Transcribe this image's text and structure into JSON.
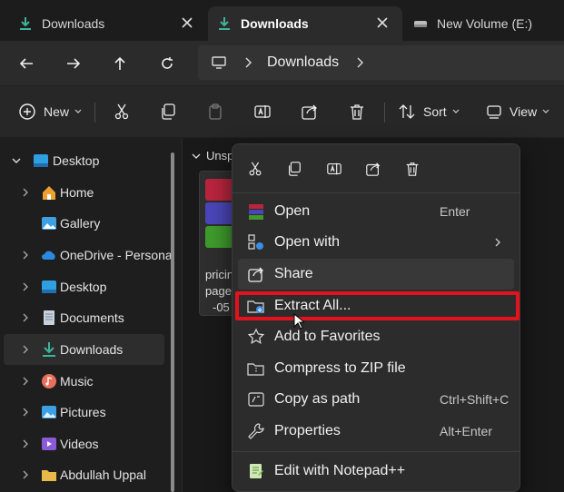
{
  "tabs": [
    {
      "label": "Downloads",
      "icon": "download-icon",
      "active": false
    },
    {
      "label": "Downloads",
      "icon": "download-icon",
      "active": true
    },
    {
      "label": "New Volume (E:)",
      "icon": "drive-icon",
      "active": false
    }
  ],
  "address": {
    "segments": [
      "Downloads"
    ],
    "root_icon": "monitor-icon"
  },
  "commandbar": {
    "new_label": "New",
    "sort_label": "Sort",
    "view_label": "View"
  },
  "sidebar": {
    "items": [
      {
        "label": "Desktop",
        "icon": "desktop-folder-icon",
        "expanded": true
      },
      {
        "label": "Home",
        "icon": "home-icon"
      },
      {
        "label": "Gallery",
        "icon": "gallery-icon"
      },
      {
        "label": "OneDrive - Personal",
        "icon": "onedrive-icon"
      },
      {
        "label": "Desktop",
        "icon": "desktop-folder-icon"
      },
      {
        "label": "Documents",
        "icon": "documents-icon"
      },
      {
        "label": "Downloads",
        "icon": "download-icon",
        "selected": true
      },
      {
        "label": "Music",
        "icon": "music-icon"
      },
      {
        "label": "Pictures",
        "icon": "pictures-icon"
      },
      {
        "label": "Videos",
        "icon": "videos-icon"
      },
      {
        "label": "Abdullah Uppal",
        "icon": "folder-icon"
      }
    ]
  },
  "content": {
    "group_header": "Unsp",
    "file_name_lines": [
      "pricin",
      "page",
      "-05"
    ]
  },
  "context_menu": {
    "quick_actions": [
      "cut-icon",
      "copy-icon",
      "rename-icon",
      "share-icon",
      "delete-icon"
    ],
    "items": [
      {
        "label": "Open",
        "shortcut": "Enter",
        "icon": "winrar-icon"
      },
      {
        "label": "Open with",
        "shortcut": "",
        "icon": "open-with-icon",
        "submenu": true
      },
      {
        "label": "Share",
        "shortcut": "",
        "icon": "share-icon"
      },
      {
        "label": "Extract All...",
        "shortcut": "",
        "icon": "extract-icon",
        "highlighted": true
      },
      {
        "label": "Add to Favorites",
        "shortcut": "",
        "icon": "star-icon"
      },
      {
        "label": "Compress to ZIP file",
        "shortcut": "",
        "icon": "zip-icon"
      },
      {
        "label": "Copy as path",
        "shortcut": "Ctrl+Shift+C",
        "icon": "copy-path-icon"
      },
      {
        "label": "Properties",
        "shortcut": "Alt+Enter",
        "icon": "wrench-icon"
      },
      {
        "label": "Edit with Notepad++",
        "shortcut": "",
        "icon": "notepadpp-icon"
      }
    ]
  },
  "colors": {
    "highlight": "#e3121e",
    "accent_download": "#3fb39a",
    "folder": "#e8b84a"
  }
}
